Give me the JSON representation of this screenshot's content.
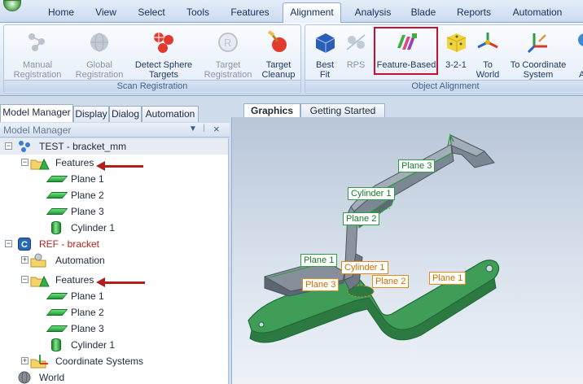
{
  "ribbon_tabs": [
    "Home",
    "View",
    "Select",
    "Tools",
    "Features",
    "Alignment",
    "Analysis",
    "Blade",
    "Reports",
    "Automation"
  ],
  "active_tab": "Alignment",
  "groups": {
    "scan_registration": {
      "label": "Scan Registration",
      "buttons": [
        {
          "label": "Manual\nRegistration",
          "icon": "manual-registration-icon",
          "enabled": false
        },
        {
          "label": "Global\nRegistration",
          "icon": "global-registration-icon",
          "enabled": false
        },
        {
          "label": "Detect Sphere\nTargets",
          "icon": "detect-sphere-icon",
          "enabled": true
        },
        {
          "label": "Target\nRegistration",
          "icon": "target-registration-icon",
          "enabled": false
        },
        {
          "label": "Target\nCleanup",
          "icon": "target-cleanup-icon",
          "enabled": true
        }
      ]
    },
    "object_alignment": {
      "label": "Object Alignment",
      "buttons": [
        {
          "label": "Best\nFit",
          "icon": "best-fit-icon",
          "enabled": true
        },
        {
          "label": "RPS",
          "icon": "rps-icon",
          "enabled": false
        },
        {
          "label": "Feature-Based",
          "icon": "feature-based-icon",
          "enabled": true,
          "highlighted": true
        },
        {
          "label": "3-2-1",
          "icon": "dice-icon",
          "enabled": true
        },
        {
          "label": "To\nWorld",
          "icon": "to-world-icon",
          "enabled": true
        },
        {
          "label": "To Coordinate\nSystem",
          "icon": "to-coordinate-system-icon",
          "enabled": true
        },
        {
          "label": "A",
          "icon": "align-icon",
          "enabled": true
        }
      ]
    }
  },
  "left_panel": {
    "tabs": [
      "Model Manager",
      "Display",
      "Dialog",
      "Automation"
    ],
    "active_tab": "Model Manager",
    "title": "Model Manager",
    "pin_glyph": "▼",
    "pin2_glyph": "ᛁ",
    "close_glyph": "×"
  },
  "tree": {
    "test_model": "TEST - bracket_mm",
    "test_features": "Features",
    "test_items": [
      "Plane 1",
      "Plane 2",
      "Plane 3",
      "Cylinder 1"
    ],
    "ref_model": "REF - bracket",
    "ref_automation": "Automation",
    "ref_features": "Features",
    "ref_items": [
      "Plane 1",
      "Plane 2",
      "Plane 3",
      "Cylinder 1"
    ],
    "ref_coord": "Coordinate Systems",
    "world": "World"
  },
  "graphics_tabs": [
    "Graphics",
    "Getting Started"
  ],
  "graphics_active_tab": "Graphics",
  "labels_test": [
    "Plane 3",
    "Cylinder 1",
    "Plane 2",
    "Plane 1"
  ],
  "labels_ref": [
    "Cylinder 1",
    "Plane 3",
    "Plane 2",
    "Plane 1"
  ],
  "colors": {
    "test_label": "#1a7a2d",
    "ref_label": "#c86f00",
    "highlight": "#c8102e",
    "arrow": "#b21e1e"
  }
}
